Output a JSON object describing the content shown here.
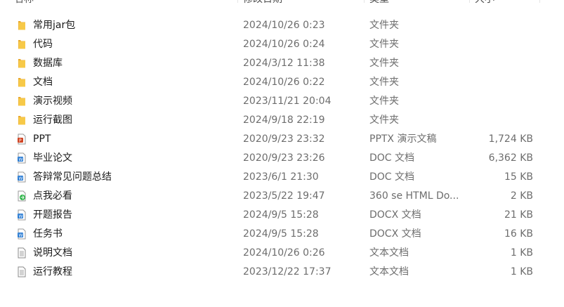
{
  "columns": {
    "name": "名称",
    "date": "修改日期",
    "type": "类型",
    "size": "大小"
  },
  "files": [
    {
      "name": "常用jar包",
      "date": "2024/10/26 0:23",
      "type": "文件夹",
      "size": "",
      "icon": "folder-icon"
    },
    {
      "name": "代码",
      "date": "2024/10/26 0:24",
      "type": "文件夹",
      "size": "",
      "icon": "folder-icon"
    },
    {
      "name": "数据库",
      "date": "2024/3/12 11:38",
      "type": "文件夹",
      "size": "",
      "icon": "folder-icon"
    },
    {
      "name": "文档",
      "date": "2024/10/26 0:22",
      "type": "文件夹",
      "size": "",
      "icon": "folder-icon"
    },
    {
      "name": "演示视频",
      "date": "2023/11/21 20:04",
      "type": "文件夹",
      "size": "",
      "icon": "folder-icon"
    },
    {
      "name": "运行截图",
      "date": "2024/9/18 22:19",
      "type": "文件夹",
      "size": "",
      "icon": "folder-icon"
    },
    {
      "name": "PPT",
      "date": "2020/9/23 23:32",
      "type": "PPTX 演示文稿",
      "size": "1,724 KB",
      "icon": "pptx-file-icon"
    },
    {
      "name": "毕业论文",
      "date": "2020/9/23 23:26",
      "type": "DOC 文档",
      "size": "6,362 KB",
      "icon": "doc-file-icon"
    },
    {
      "name": "答辩常见问题总结",
      "date": "2023/6/1 21:30",
      "type": "DOC 文档",
      "size": "15 KB",
      "icon": "doc-file-icon"
    },
    {
      "name": "点我必看",
      "date": "2023/5/22 19:47",
      "type": "360 se HTML Do...",
      "size": "2 KB",
      "icon": "html-file-icon"
    },
    {
      "name": "开题报告",
      "date": "2024/9/5 15:28",
      "type": "DOCX 文档",
      "size": "21 KB",
      "icon": "docx-file-icon"
    },
    {
      "name": "任务书",
      "date": "2024/9/5 15:28",
      "type": "DOCX 文档",
      "size": "16 KB",
      "icon": "docx-file-icon"
    },
    {
      "name": "说明文档",
      "date": "2024/10/26 0:26",
      "type": "文本文档",
      "size": "1 KB",
      "icon": "text-file-icon"
    },
    {
      "name": "运行教程",
      "date": "2023/12/22 17:37",
      "type": "文本文档",
      "size": "1 KB",
      "icon": "text-file-icon"
    }
  ],
  "colors": {
    "folder": "#f5c242",
    "pptx": "#d04423",
    "doc": "#2b7cd3",
    "html": "#2fb54a"
  }
}
